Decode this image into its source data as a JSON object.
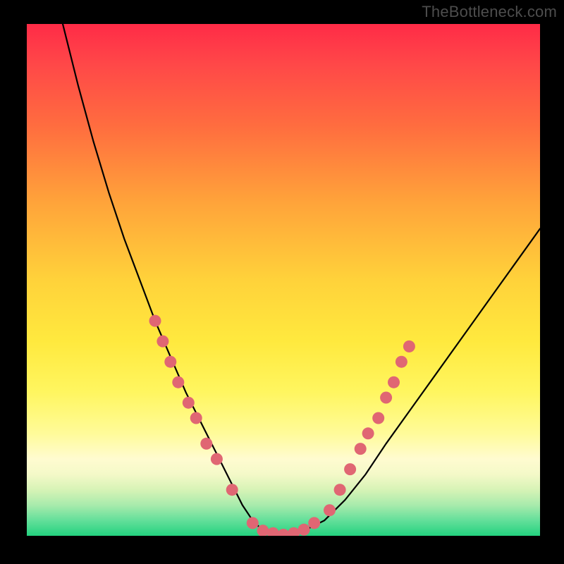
{
  "watermark": "TheBottleneck.com",
  "colors": {
    "dot": "#e06673",
    "line": "#000000",
    "gradient_top": "#ff2b47",
    "gradient_bottom": "#23d27f",
    "frame": "#000000"
  },
  "chart_data": {
    "type": "line",
    "title": "",
    "xlabel": "",
    "ylabel": "",
    "xlim": [
      0,
      100
    ],
    "ylim": [
      0,
      100
    ],
    "series": [
      {
        "name": "bottleneck-curve",
        "x": [
          7,
          10,
          13,
          16,
          19,
          22,
          25,
          28,
          31,
          34,
          37,
          39.5,
          42,
          44,
          46,
          50,
          54,
          58,
          62,
          66,
          70,
          75,
          80,
          85,
          90,
          95,
          100
        ],
        "y": [
          100,
          88,
          77,
          67,
          58,
          50,
          42,
          35,
          28,
          22,
          16,
          11,
          6,
          3,
          1,
          0,
          1,
          3,
          7,
          12,
          18,
          25,
          32,
          39,
          46,
          53,
          60
        ]
      }
    ],
    "markers": [
      {
        "x": 25.0,
        "y": 42
      },
      {
        "x": 26.5,
        "y": 38
      },
      {
        "x": 28.0,
        "y": 34
      },
      {
        "x": 29.5,
        "y": 30
      },
      {
        "x": 31.5,
        "y": 26
      },
      {
        "x": 33.0,
        "y": 23
      },
      {
        "x": 35.0,
        "y": 18
      },
      {
        "x": 37.0,
        "y": 15
      },
      {
        "x": 40.0,
        "y": 9
      },
      {
        "x": 44.0,
        "y": 2.5
      },
      {
        "x": 46.0,
        "y": 1.0
      },
      {
        "x": 48.0,
        "y": 0.5
      },
      {
        "x": 50.0,
        "y": 0.2
      },
      {
        "x": 52.0,
        "y": 0.5
      },
      {
        "x": 54.0,
        "y": 1.2
      },
      {
        "x": 56.0,
        "y": 2.5
      },
      {
        "x": 59.0,
        "y": 5
      },
      {
        "x": 61.0,
        "y": 9
      },
      {
        "x": 63.0,
        "y": 13
      },
      {
        "x": 65.0,
        "y": 17
      },
      {
        "x": 66.5,
        "y": 20
      },
      {
        "x": 68.5,
        "y": 23
      },
      {
        "x": 70.0,
        "y": 27
      },
      {
        "x": 71.5,
        "y": 30
      },
      {
        "x": 73.0,
        "y": 34
      },
      {
        "x": 74.5,
        "y": 37
      }
    ]
  }
}
